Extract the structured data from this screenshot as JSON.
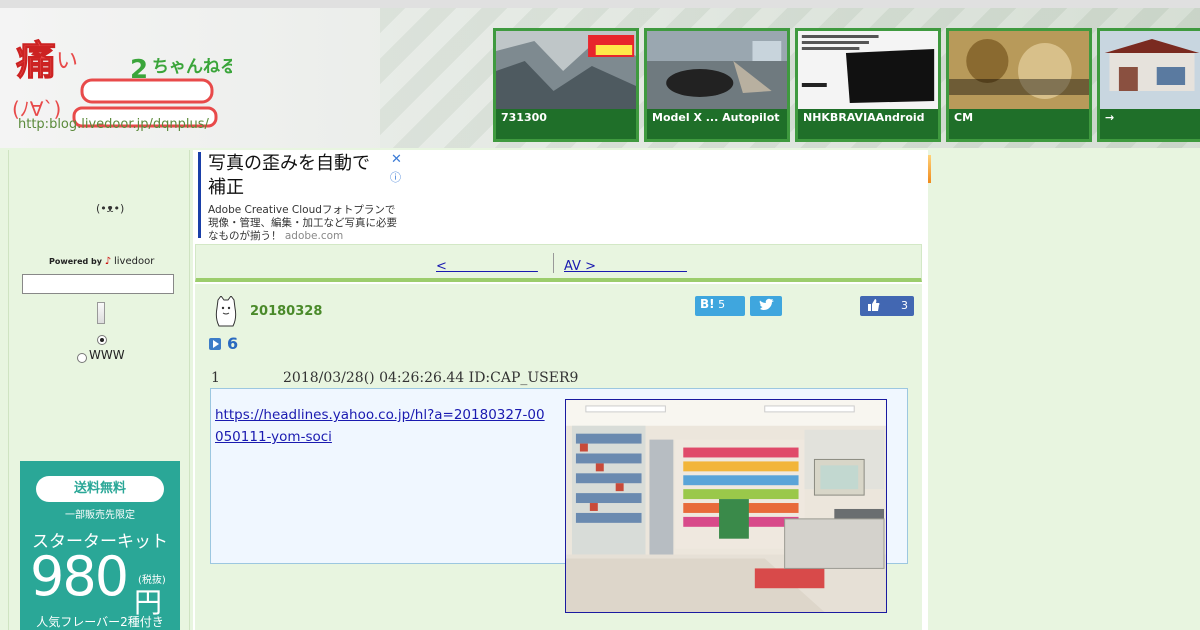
{
  "header": {
    "logo_url_text": "http:blog.livedoor.jp/dqnplus/",
    "colors": {
      "thumb_border": "#3f9a3f",
      "caption_bg": "#1e6e28"
    },
    "thumbnails": [
      {
        "caption": "731300"
      },
      {
        "caption": " Model X ... Autopilot"
      },
      {
        "caption": "NHKBRAVIAAndroid"
      },
      {
        "caption": "CM"
      },
      {
        "caption": "→"
      }
    ]
  },
  "sidebar": {
    "ascii_face": "(•ᴥ•)",
    "powered_by": "Powered by",
    "livedoor": "livedoor",
    "search_placeholder": "",
    "www_label": "WWW"
  },
  "promo": {
    "pill": "送料無料",
    "sub": "一部販売先限定",
    "kit": "スターターキット",
    "price": "980",
    "tax": "(税抜)",
    "yen": "円",
    "bottom": "人気フレーバー2種付き"
  },
  "ad": {
    "title": "写真の歪みを自動で補正",
    "body": "Adobe Creative Cloudフォトプランで現像・管理、編集・加工など写真に必要なものが揃う！",
    "host": "adobe.com",
    "close": "✕",
    "info": "ⓘ"
  },
  "pager": {
    "prev": "<　　　　　　　",
    "next": "AV >　　　　　　　"
  },
  "article": {
    "date_title": "20180328",
    "hatena_label": "B!",
    "hatena_count": "5",
    "like_count": "3",
    "comment_count": "6",
    "post_number": "1",
    "post_meta": "2018/03/28() 04:26:26.44 ID:CAP_USER9",
    "post_link": "https://headlines.yahoo.co.jp/hl?a=20180327-00050111-yom-soci"
  }
}
